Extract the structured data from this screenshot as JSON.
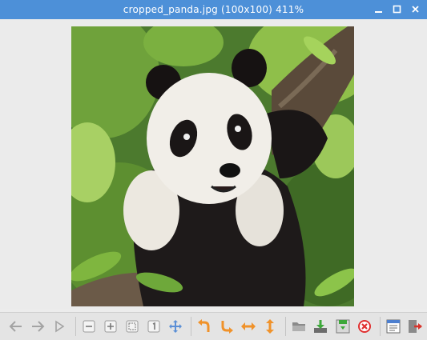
{
  "window": {
    "title": "cropped_panda.jpg (100x100) 411%"
  },
  "colors": {
    "titlebar": "#4d90d8",
    "viewport_bg": "#ebebeb",
    "toolbar_bg": "#e4e4e4",
    "orange_icon": "#f0922a",
    "gray_icon": "#9a9a9a"
  },
  "image": {
    "filename": "cropped_panda.jpg",
    "size": "100x100",
    "zoom": "411%",
    "subject": "giant panda"
  },
  "toolbar": {
    "icons": [
      "previous-icon",
      "next-icon",
      "slideshow-icon",
      "zoom-out-icon",
      "zoom-in-icon",
      "fit-icon",
      "original-size-icon",
      "fullscreen-icon",
      "rotate-left-icon",
      "rotate-right-icon",
      "flip-horizontal-icon",
      "flip-vertical-icon",
      "open-file-icon",
      "save-icon",
      "save-as-icon",
      "delete-icon",
      "preferences-icon",
      "quit-icon"
    ]
  }
}
